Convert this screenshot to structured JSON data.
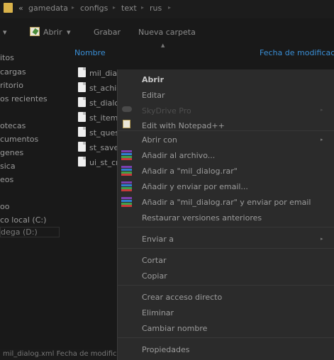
{
  "address": {
    "back": "«",
    "crumbs": [
      "gamedata",
      "configs",
      "text",
      "rus"
    ]
  },
  "toolbar": {
    "left_arrow": "▾",
    "open_label": "Abrir",
    "open_arrow": "▾",
    "record_label": "Grabar",
    "new_folder_label": "Nueva carpeta"
  },
  "columns": {
    "name": "Nombre",
    "date": "Fecha de modificac...",
    "sort": "▲"
  },
  "sidebar": {
    "items": [
      "itos",
      "cargas",
      "ritorio",
      "os recientes",
      "otecas",
      "cumentos",
      "genes",
      "sica",
      "eos",
      "oo",
      "co local (C:)",
      "dega (D:)"
    ]
  },
  "files": [
    "mil_dial",
    "st_achie",
    "st_dialo",
    "st_items",
    "st_ques",
    "st_save_",
    "ui_st_cr"
  ],
  "status": {
    "text": "mil_dialog.xml  Fecha de modific"
  },
  "menu": {
    "open": "Abrir",
    "edit": "Editar",
    "skydrive": "SkyDrive Pro",
    "notepad": "Edit with Notepad++",
    "open_with": "Abrir con",
    "add_archive": "Añadir al archivo...",
    "add_rar": "Añadir a \"mil_dialog.rar\"",
    "add_email": "Añadir y enviar por email...",
    "add_rar_email": "Añadir a \"mil_dialog.rar\" y enviar por email",
    "restore": "Restaurar versiones anteriores",
    "send_to": "Enviar a",
    "cut": "Cortar",
    "copy": "Copiar",
    "shortcut": "Crear acceso directo",
    "delete": "Eliminar",
    "rename": "Cambiar nombre",
    "properties": "Propiedades",
    "arrow": "▸"
  },
  "colors": {
    "accent": "#3a8fd6",
    "background": "#191919",
    "menu_bg": "#2b2b2b"
  }
}
